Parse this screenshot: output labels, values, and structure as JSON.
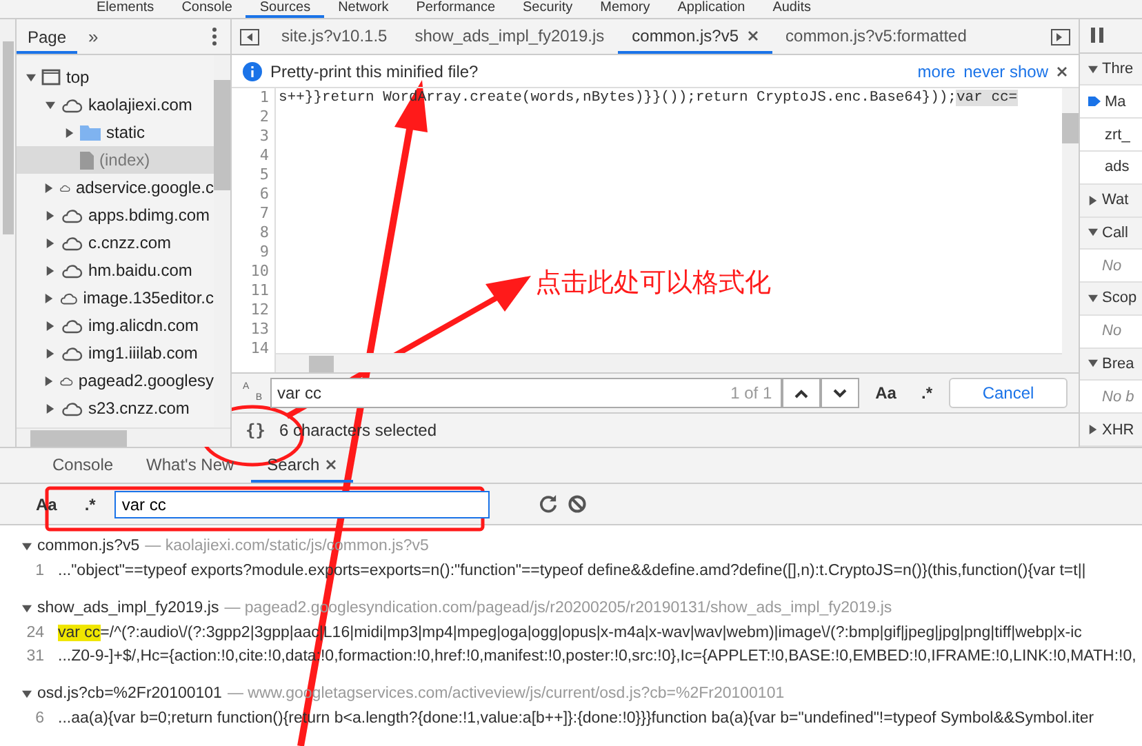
{
  "main_tabs": [
    {
      "label": "Elements",
      "selected": false
    },
    {
      "label": "Console",
      "selected": false
    },
    {
      "label": "Sources",
      "selected": true
    },
    {
      "label": "Network",
      "selected": false
    },
    {
      "label": "Performance",
      "selected": false
    },
    {
      "label": "Security",
      "selected": false
    },
    {
      "label": "Memory",
      "selected": false
    },
    {
      "label": "Application",
      "selected": false
    },
    {
      "label": "Audits",
      "selected": false
    }
  ],
  "navigator": {
    "tabs": [
      {
        "label": "Page",
        "selected": true
      }
    ],
    "more": "»",
    "tree": [
      {
        "label": "top",
        "kind": "frame",
        "expanded": true,
        "selected": false,
        "children": [
          {
            "label": "kaolajiexi.com",
            "kind": "domain",
            "expanded": true,
            "selected": false,
            "children": [
              {
                "label": "static",
                "kind": "folder",
                "expanded": false,
                "selected": false
              },
              {
                "label": "(index)",
                "kind": "file",
                "expanded": false,
                "selected": true
              }
            ]
          },
          {
            "label": "adservice.google.c",
            "kind": "domain",
            "expanded": false,
            "selected": false
          },
          {
            "label": "apps.bdimg.com",
            "kind": "domain",
            "expanded": false,
            "selected": false
          },
          {
            "label": "c.cnzz.com",
            "kind": "domain",
            "expanded": false,
            "selected": false
          },
          {
            "label": "hm.baidu.com",
            "kind": "domain",
            "expanded": false,
            "selected": false
          },
          {
            "label": "image.135editor.c",
            "kind": "domain",
            "expanded": false,
            "selected": false
          },
          {
            "label": "img.alicdn.com",
            "kind": "domain",
            "expanded": false,
            "selected": false
          },
          {
            "label": "img1.iiilab.com",
            "kind": "domain",
            "expanded": false,
            "selected": false
          },
          {
            "label": "pagead2.googlesy",
            "kind": "domain",
            "expanded": false,
            "selected": false
          },
          {
            "label": "s23.cnzz.com",
            "kind": "domain",
            "expanded": false,
            "selected": false
          }
        ]
      }
    ]
  },
  "editor": {
    "tabs": [
      {
        "label": "site.js?v10.1.5",
        "selected": false,
        "closable": false
      },
      {
        "label": "show_ads_impl_fy2019.js",
        "selected": false,
        "closable": false
      },
      {
        "label": "common.js?v5",
        "selected": true,
        "closable": true
      },
      {
        "label": "common.js?v5:formatted",
        "selected": false,
        "closable": false
      }
    ],
    "infobar": {
      "message": "Pretty-print this minified file?",
      "links": [
        "more",
        "never show"
      ]
    },
    "line_numbers": [
      "1",
      "2",
      "3",
      "4",
      "5",
      "6",
      "7",
      "8",
      "9",
      "10",
      "11",
      "12",
      "13",
      "14"
    ],
    "code_line": {
      "text": "s++}}return WordArray.create(words,nBytes)}}());return CryptoJS.enc.Base64}));",
      "selection": "var cc="
    },
    "find": {
      "replace_toggle": [
        "A",
        "B"
      ],
      "value": "var cc",
      "count": "1 of 1",
      "case_label": "Aa",
      "regex_label": ".*",
      "cancel": "Cancel"
    },
    "status": {
      "format_button": "{}",
      "text": "6 characters selected"
    }
  },
  "debugger": {
    "sections": [
      {
        "label": "Thre",
        "kind": "header",
        "expanded": true
      },
      {
        "label": "Ma",
        "kind": "thread"
      },
      {
        "label": "zrt_",
        "kind": "item"
      },
      {
        "label": "ads",
        "kind": "item"
      },
      {
        "label": "Wat",
        "kind": "header",
        "expanded": false
      },
      {
        "label": "Call",
        "kind": "header",
        "expanded": true
      },
      {
        "label": "No",
        "kind": "empty"
      },
      {
        "label": "Scop",
        "kind": "header",
        "expanded": true
      },
      {
        "label": "No",
        "kind": "empty"
      },
      {
        "label": "Brea",
        "kind": "header",
        "expanded": true
      },
      {
        "label": "No b",
        "kind": "empty"
      },
      {
        "label": "XHR",
        "kind": "header",
        "expanded": false
      }
    ]
  },
  "drawer": {
    "tabs": [
      {
        "label": "Console",
        "selected": false,
        "closable": false
      },
      {
        "label": "What's New",
        "selected": false,
        "closable": false
      },
      {
        "label": "Search",
        "selected": true,
        "closable": true
      }
    ],
    "search": {
      "case_label": "Aa",
      "regex_label": ".*",
      "value": "var cc"
    },
    "results": [
      {
        "file": "common.js?v5",
        "url": "— kaolajiexi.com/static/js/common.js?v5",
        "expanded": true,
        "lines": [
          {
            "number": "1",
            "text": "...\"object\"==typeof exports?module.exports=exports=n():\"function\"==typeof define&&define.amd?define([],n):t.CryptoJS=n()}(this,function(){var t=t||"
          }
        ]
      },
      {
        "file": "show_ads_impl_fy2019.js",
        "url": "— pagead2.googlesyndication.com/pagead/js/r20200205/r20190131/show_ads_impl_fy2019.js",
        "expanded": true,
        "lines": [
          {
            "number": "24",
            "match": "var cc",
            "text": "=/^(?:audio\\/(?:3gpp2|3gpp|aac|L16|midi|mp3|mp4|mpeg|oga|ogg|opus|x-m4a|x-wav|wav|webm)|image\\/(?:bmp|gif|jpeg|jpg|png|tiff|webp|x-ic"
          },
          {
            "number": "31",
            "text": "...Z0-9-]+$/,Hc={action:!0,cite:!0,data:!0,formaction:!0,href:!0,manifest:!0,poster:!0,src:!0},Ic={APPLET:!0,BASE:!0,EMBED:!0,IFRAME:!0,LINK:!0,MATH:!0,"
          }
        ]
      },
      {
        "file": "osd.js?cb=%2Fr20100101",
        "url": "— www.googletagservices.com/activeview/js/current/osd.js?cb=%2Fr20100101",
        "expanded": true,
        "lines": [
          {
            "number": "6",
            "text": "...aa(a){var b=0;return function(){return b<a.length?{done:!1,value:a[b++]}:{done:!0}}}function ba(a){var b=\"undefined\"!=typeof Symbol&&Symbol.iter"
          }
        ]
      }
    ]
  },
  "annotation": {
    "text": "点击此处可以格式化"
  }
}
